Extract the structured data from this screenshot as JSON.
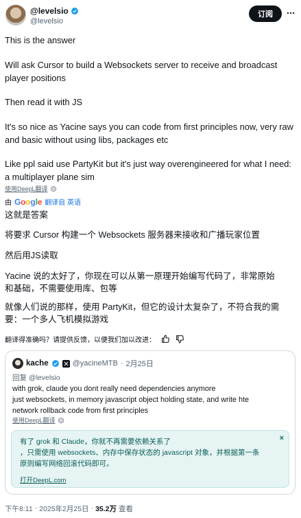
{
  "author": {
    "name": "@levelsio",
    "handle": "@levelsio",
    "verified": true,
    "subscribe_label": "订阅"
  },
  "tweet": {
    "paragraphs": [
      "This is the answer",
      "Will ask Cursor to build a Websockets server to receive and broadcast player positions",
      "Then read it with JS",
      "It's so nice as Yacine says you can code from first principles now, very raw and basic without using libs, packages etc",
      "Like ppl said use PartyKit but it's just way overengineered for what I need: a multiplayer plane sim"
    ],
    "deepl_label": "使用DeepL翻译",
    "google_by": "由",
    "google_logo": "Google",
    "google_translate_label": "翻译自 英语",
    "translated_paragraphs": [
      "这就是答案",
      "将要求 Cursor 构建一个 Websockets 服务器来接收和广播玩家位置",
      "然后用JS读取",
      "Yacine 说的太好了，你现在可以从第一原理开始编写代码了，非常原始和基础，不需要使用库、包等",
      "就像人们说的那样，使用 PartyKit，但它的设计太复杂了，不符合我的需要：一个多人飞机模拟游戏"
    ],
    "feedback_prompt": "翻译得准确吗？请提供反馈，以便我们加以改进："
  },
  "quote": {
    "name": "kache",
    "handle": "@yacineMTB",
    "date": "2月25日",
    "reply_prefix": "回复",
    "reply_to": "@levelsio",
    "body_lines": [
      "with grok, claude you dont really need dependencies anymore",
      "just websockets, in memory javascript object holding state, and write hte",
      "network rollback code from first principles"
    ],
    "deepl_label": "使用DeepL翻译",
    "translation_lines": [
      "有了 grok 和 Claude，你就不再需要依赖关系了",
      "，只需使用 websockets、内存中保存状态的 javascript 对象，并根据第一条",
      "原则编写网络回滚代码即可。"
    ],
    "translation_close": "×",
    "open_deepl_label": "打开DeepL.com"
  },
  "footer": {
    "time": "下午8:11",
    "dot": "·",
    "date": "2025年2月25日",
    "views": "35.2万",
    "views_label": "查看"
  },
  "colors": {
    "verified_blue": "#1d9bf0",
    "translation_bg": "#e6f4f3",
    "google_blue": "#1a73e8"
  }
}
